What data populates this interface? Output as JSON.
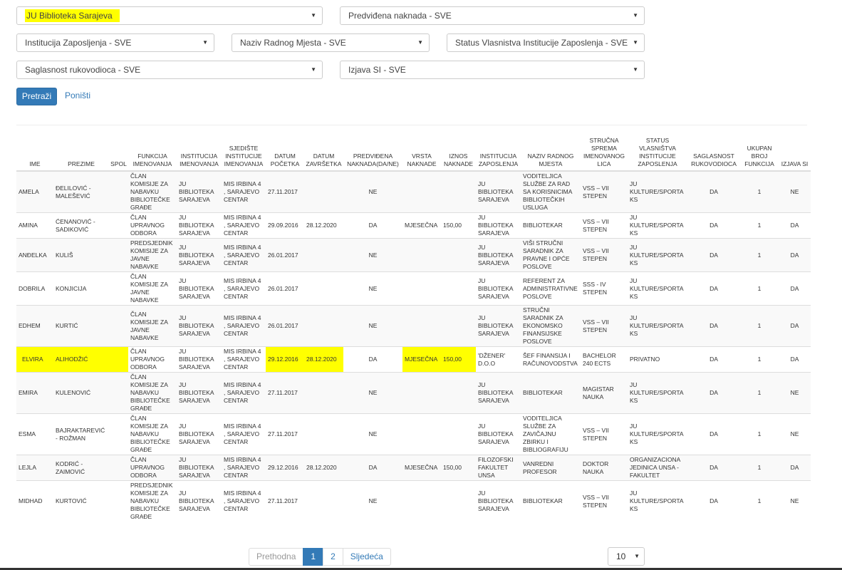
{
  "filters": {
    "biblioteka": "JU Biblioteka Sarajeva",
    "naknada": "Predviđena naknada - SVE",
    "institucija": "Institucija Zaposljenja - SVE",
    "radno_mjesto": "Naziv Radnog Mjesta - SVE",
    "status": "Status Vlasnistva Institucije Zaposlenja - SVE",
    "saglasnost": "Saglasnost rukovodioca - SVE",
    "izjava": "Izjava SI - SVE"
  },
  "buttons": {
    "search": "Pretraži",
    "reset": "Poništi"
  },
  "headers": [
    "IME",
    "PREZIME",
    "SPOL",
    "FUNKCIJA IMENOVANJA",
    "INSTITUCIJA IMENOVANJA",
    "SJEDIŠTE INSTITUCIJE IMENOVANJA",
    "DATUM POČETKA",
    "DATUM ZAVRŠETKA",
    "PREDVIĐENA NAKNADA(DA/NE)",
    "VRSTA NAKNADE",
    "IZNOS NAKNADE",
    "INSTITUCIJA ZAPOSLENJA",
    "NAZIV RADNOG MJESTA",
    "STRUČNA SPREMA IMENOVANOG LICA",
    "STATUS VLASNIŠTVA INSTITUCIJE ZAPOSLENJA",
    "SAGLASNOST RUKOVODIOCA",
    "UKUPAN BROJ FUNKCIJA",
    "IZJAVA SI"
  ],
  "rows": [
    [
      "AMELA",
      "ĐELILOVIĆ - MALEŠEVIĆ",
      "",
      "ČLAN KOMISIJE ZA NABAVKU BIBLIOTEČKE GRAĐE",
      "JU BIBLIOTEKA SARAJEVA",
      "MIS IRBINA 4 , SARAJEVO CENTAR",
      "27.11.2017",
      "",
      "NE",
      "",
      "",
      "JU BIBLIOTEKA SARAJEVA",
      "VODITELJICA SLUŽBE ZA RAD SA KORISNICIMA BIBLIOTEČKIH USLUGA",
      "VSS – VII STEPEN",
      "JU KULTURE/SPORTA KS",
      "DA",
      "1",
      "NE"
    ],
    [
      "AMINA",
      "ĆENANOVIĆ - SADIKOVIĆ",
      "",
      "ČLAN UPRAVNOG ODBORA",
      "JU BIBLIOTEKA SARAJEVA",
      "MIS IRBINA 4 , SARAJEVO CENTAR",
      "29.09.2016",
      "28.12.2020",
      "DA",
      "MJESEČNA",
      "150,00",
      "JU BIBLIOTEKA SARAJEVA",
      "BIBLIOTEKAR",
      "VSS – VII STEPEN",
      "JU KULTURE/SPORTA KS",
      "DA",
      "1",
      "DA"
    ],
    [
      "ANĐELKA",
      "KULIŠ",
      "",
      "PREDSJEDNIK KOMISIJE ZA JAVNE NABAVKE",
      "JU BIBLIOTEKA SARAJEVA",
      "MIS IRBINA 4 , SARAJEVO CENTAR",
      "26.01.2017",
      "",
      "NE",
      "",
      "",
      "JU BIBLIOTEKA SARAJEVA",
      "VIŠI STRUČNI SARADNIK ZA PRAVNE I OPĆE POSLOVE",
      "VSS – VII STEPEN",
      "JU KULTURE/SPORTA KS",
      "DA",
      "1",
      "DA"
    ],
    [
      "DOBRILA",
      "KONJICIJA",
      "",
      "ČLAN KOMISIJE ZA JAVNE NABAVKE",
      "JU BIBLIOTEKA SARAJEVA",
      "MIS IRBINA 4 , SARAJEVO CENTAR",
      "26.01.2017",
      "",
      "NE",
      "",
      "",
      "JU BIBLIOTEKA SARAJEVA",
      "REFERENT ZA ADMINISTRATIVNE POSLOVE",
      "SSS - IV STEPEN",
      "JU KULTURE/SPORTA KS",
      "DA",
      "1",
      "DA"
    ],
    [
      "EDHEM",
      "KURTIĆ",
      "",
      "ČLAN KOMISIJE ZA JAVNE NABAVKE",
      "JU BIBLIOTEKA SARAJEVA",
      "MIS IRBINA 4 , SARAJEVO CENTAR",
      "26.01.2017",
      "",
      "NE",
      "",
      "",
      "JU BIBLIOTEKA SARAJEVA",
      "STRUČNI SARADNIK ZA EKONOMSKO FINANSIJSKE POSLOVE",
      "VSS – VII STEPEN",
      "JU KULTURE/SPORTA KS",
      "DA",
      "1",
      "DA"
    ],
    [
      "ELVIRA",
      "ALIHODŽIĆ",
      "",
      "ČLAN UPRAVNOG ODBORA",
      "JU BIBLIOTEKA SARAJEVA",
      "MIS IRBINA 4 , SARAJEVO CENTAR",
      "29.12.2016",
      "28.12.2020",
      "DA",
      "MJESEČNA",
      "150,00",
      "'DŽENER' D.O.O",
      "ŠEF FINANSIJA I RAČUNOVODSTVA",
      "BACHELOR 240 ECTS",
      "PRIVATNO",
      "DA",
      "1",
      "DA"
    ],
    [
      "EMIRA",
      "KULENOVIĆ",
      "",
      "ČLAN KOMISIJE ZA NABAVKU BIBLIOTEČKE GRAĐE",
      "JU BIBLIOTEKA SARAJEVA",
      "MIS IRBINA 4 , SARAJEVO CENTAR",
      "27.11.2017",
      "",
      "NE",
      "",
      "",
      "JU BIBLIOTEKA SARAJEVA",
      "BIBLIOTEKAR",
      "MAGISTAR NAUKA",
      "JU KULTURE/SPORTA KS",
      "DA",
      "1",
      "NE"
    ],
    [
      "ESMA",
      "BAJRAKTAREVIĆ - ROŽMAN",
      "",
      "ČLAN KOMISIJE ZA NABAVKU BIBLIOTEČKE GRAĐE",
      "JU BIBLIOTEKA SARAJEVA",
      "MIS IRBINA 4 , SARAJEVO CENTAR",
      "27.11.2017",
      "",
      "NE",
      "",
      "",
      "JU BIBLIOTEKA SARAJEVA",
      "VODITELJICA SLUŽBE ZA ZAVIČAJNU ZBIRKU I BIBLIOGRAFIJU",
      "VSS – VII STEPEN",
      "JU KULTURE/SPORTA KS",
      "DA",
      "1",
      "NE"
    ],
    [
      "LEJLA",
      "KODRIĆ - ZAIMOVIĆ",
      "",
      "ČLAN UPRAVNOG ODBORA",
      "JU BIBLIOTEKA SARAJEVA",
      "MIS IRBINA 4 , SARAJEVO CENTAR",
      "29.12.2016",
      "28.12.2020",
      "DA",
      "MJESEČNA",
      "150,00",
      "FILOZOFSKI FAKULTET UNSA",
      "VANREDNI PROFESOR",
      "DOKTOR NAUKA",
      "ORGANIZACIONA JEDINICA UNSA - FAKULTET",
      "DA",
      "1",
      "DA"
    ],
    [
      "MIDHAD",
      "KURTOVIĆ",
      "",
      "PREDSJEDNIK KOMISIJE ZA NABAVKU BIBLIOTEČKE GRAĐE",
      "JU BIBLIOTEKA SARAJEVA",
      "MIS IRBINA 4 , SARAJEVO CENTAR",
      "27.11.2017",
      "",
      "NE",
      "",
      "",
      "JU BIBLIOTEKA SARAJEVA",
      "BIBLIOTEKAR",
      "VSS – VII STEPEN",
      "JU KULTURE/SPORTA KS",
      "DA",
      "1",
      "NE"
    ]
  ],
  "pagination": {
    "prev": "Prethodna",
    "page1": "1",
    "page2": "2",
    "next": "Sljedeća"
  },
  "page_size": "10",
  "colors": {
    "primary": "#337ab7",
    "highlight": "#ffff00"
  }
}
